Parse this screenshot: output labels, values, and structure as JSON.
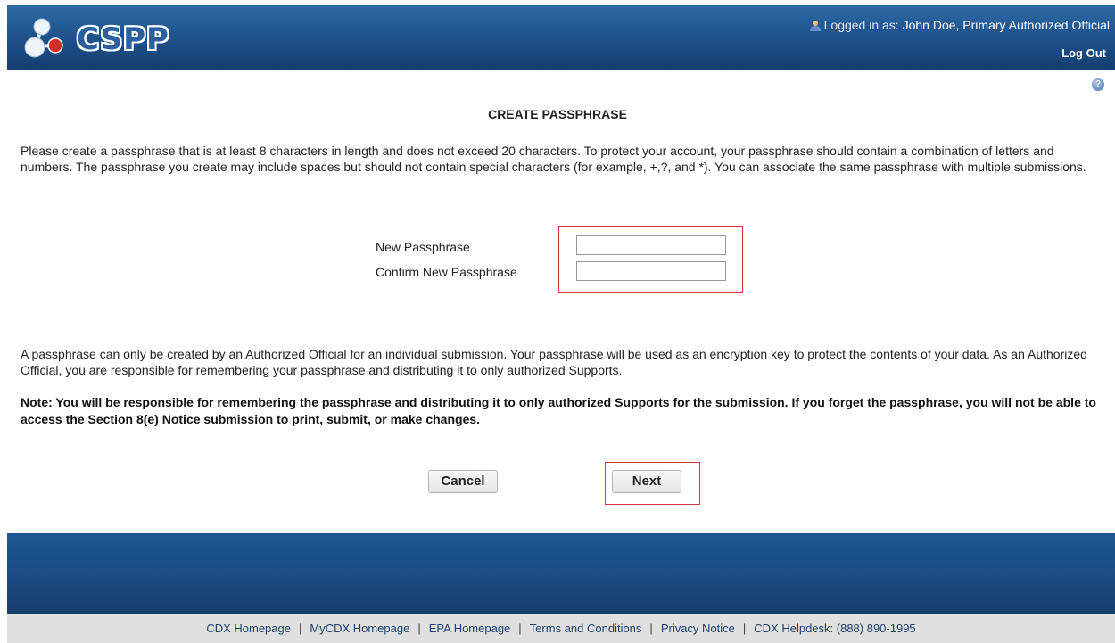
{
  "header": {
    "logo_text": "CSPP",
    "logged_in_prefix": "Logged in as: ",
    "user_name": "John Doe, Primary Authorized Official",
    "logout_label": "Log Out"
  },
  "help": {
    "icon": "help-icon"
  },
  "page": {
    "title": "CREATE PASSPHRASE",
    "intro": "Please create a passphrase that is at least 8 characters in length and does not exceed 20 characters. To protect your account, your passphrase should contain a combination of letters and numbers. The passphrase you create may include spaces but should not contain special characters (for example, +,?, and *). You can associate the same passphrase with multiple submissions.",
    "explanation": "A passphrase can only be created by an Authorized Official for an individual submission. Your passphrase will be used as an encryption key to protect the contents of your data. As an Authorized Official, you are responsible for remembering your passphrase and distributing it to only authorized Supports.",
    "note": "Note: You will be responsible for remembering the passphrase and distributing it to only authorized Supports for the submission. If you forget the passphrase, you will not be able to access the Section 8(e) Notice submission to print, submit, or make changes."
  },
  "form": {
    "new_label": "New Passphrase",
    "new_value": "",
    "confirm_label": "Confirm New Passphrase",
    "confirm_value": ""
  },
  "buttons": {
    "cancel": "Cancel",
    "next": "Next"
  },
  "colors": {
    "header": "#1d4f88",
    "highlight": "#d9363e",
    "footer": "#1a4a80",
    "footer_links_bg": "#dfdfdf"
  },
  "footer": {
    "links": [
      "CDX Homepage",
      "MyCDX Homepage",
      "EPA Homepage",
      "Terms and Conditions",
      "Privacy Notice",
      "CDX Helpdesk: (888) 890-1995"
    ],
    "separator": "|"
  }
}
